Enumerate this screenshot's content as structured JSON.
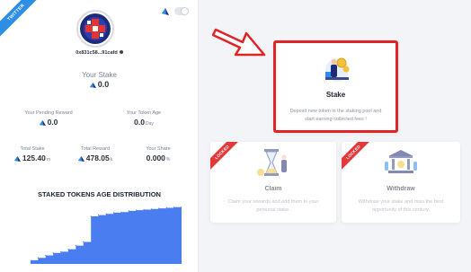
{
  "sidebar": {
    "badge": "TWITTER",
    "address": "0x831c58...91cafd",
    "your_stake": {
      "label": "Your Stake",
      "value": "0.0"
    },
    "pending_reward": {
      "label": "Your Pending Reward",
      "value": "0.0"
    },
    "token_age": {
      "label": "Your Token Age",
      "value": "0.0",
      "unit": "Day"
    },
    "total_stake": {
      "label": "Total Stake",
      "value": "125.40",
      "unit": "m"
    },
    "total_reward": {
      "label": "Total Reward",
      "value": "478.05",
      "unit": "k"
    },
    "your_share": {
      "label": "Your Share",
      "value": "0.000",
      "unit": "%"
    },
    "distribution_title": "STAKED TOKENS AGE DISTRIBUTION"
  },
  "cards": {
    "stake": {
      "title": "Stake",
      "description": "Deposit new token in the staking pool and start earning collected fees !"
    },
    "claim": {
      "badge": "LOCKED",
      "title": "Claim",
      "description": "Claim your rewards and add them to your personal stake."
    },
    "withdraw": {
      "badge": "LOCKED",
      "title": "Withdraw",
      "description": "Withdraw your stake and miss the best opportunity of this century."
    }
  },
  "colors": {
    "accent": "#2d8ee6",
    "highlight": "#e02424",
    "locked": "#e23a3a",
    "chart_fill": "#4a7df0"
  },
  "icons": [
    "twitter-ribbon",
    "avatar-logo",
    "theme-icon",
    "toggle-switch",
    "copy-icon",
    "token-icon",
    "arrow-icon"
  ],
  "chart_data": {
    "type": "area",
    "title": "STAKED TOKENS AGE DISTRIBUTION",
    "xlabel": "",
    "ylabel": "",
    "ylim": [
      0,
      1
    ],
    "x": [
      0,
      0.05,
      0.1,
      0.15,
      0.2,
      0.25,
      0.3,
      0.35,
      0.4,
      0.45,
      0.5,
      0.55,
      0.6,
      0.65,
      0.7,
      0.75,
      0.8,
      0.85,
      0.9,
      0.95,
      1.0
    ],
    "values": [
      0.06,
      0.1,
      0.14,
      0.18,
      0.2,
      0.24,
      0.3,
      0.36,
      0.78,
      0.8,
      0.82,
      0.84,
      0.85,
      0.87,
      0.88,
      0.89,
      0.9,
      0.91,
      0.92,
      0.93,
      0.94
    ],
    "grid": false
  }
}
